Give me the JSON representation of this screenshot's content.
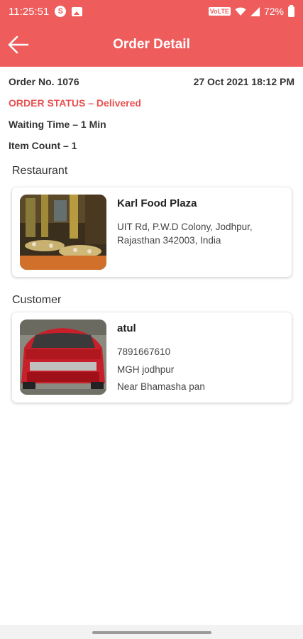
{
  "status_bar": {
    "time": "11:25:51",
    "battery": "72%",
    "volte": "VoLTE",
    "skype_glyph": "S"
  },
  "header": {
    "title": "Order Detail",
    "back_icon": "arrow-left-icon"
  },
  "order": {
    "number": "Order No. 1076",
    "datetime": "27 Oct 2021 18:12 PM",
    "status": "ORDER STATUS – Delivered",
    "waiting_time": "Waiting Time – 1 Min",
    "item_count": "Item Count – 1"
  },
  "restaurant": {
    "section_label": "Restaurant",
    "name": "Karl Food Plaza",
    "address": "UIT Rd, P.W.D Colony, Jodhpur, Rajasthan 342003, India"
  },
  "customer": {
    "section_label": "Customer",
    "name": "atul",
    "phone": "7891667610",
    "area": "MGH jodhpur",
    "landmark": "Near Bhamasha pan"
  },
  "colors": {
    "brand_red": "#ee5c5c",
    "status_red": "#e85050"
  }
}
